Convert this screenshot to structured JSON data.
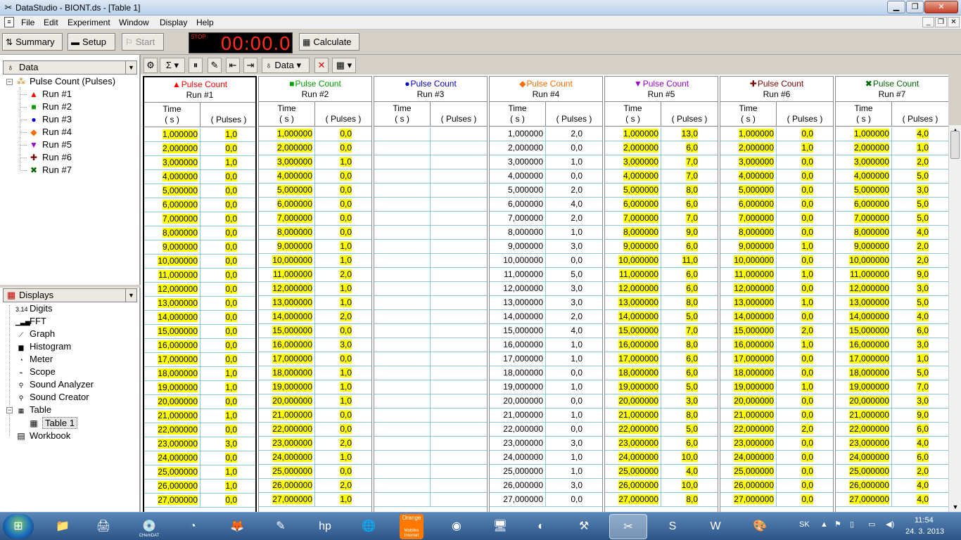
{
  "window": {
    "title": "DataStudio - BIONT.ds - [Table 1]",
    "min_label": "▁",
    "max_label": "❐",
    "close_label": "✕"
  },
  "menu": {
    "items": [
      "File",
      "Edit",
      "Experiment",
      "Window",
      "Display",
      "Help"
    ]
  },
  "toolbar": {
    "summary": "Summary",
    "setup": "Setup",
    "start": "Start",
    "stop": "STOP",
    "timer": "00:00.0",
    "calculate": "Calculate"
  },
  "data_panel": {
    "header": "Data",
    "root": "Pulse Count (Pulses)",
    "runs": [
      {
        "label": "Run #1",
        "marker": "▲",
        "color": "#ff0000"
      },
      {
        "label": "Run #2",
        "marker": "■",
        "color": "#00a000"
      },
      {
        "label": "Run #3",
        "marker": "●",
        "color": "#0000cc"
      },
      {
        "label": "Run #4",
        "marker": "◆",
        "color": "#ff6a00"
      },
      {
        "label": "Run #5",
        "marker": "▼",
        "color": "#9900cc"
      },
      {
        "label": "Run #6",
        "marker": "✚",
        "color": "#800000"
      },
      {
        "label": "Run #7",
        "marker": "✖",
        "color": "#006600"
      }
    ]
  },
  "displays_panel": {
    "header": "Displays",
    "items": [
      {
        "label": "Digits",
        "icon": "3.14"
      },
      {
        "label": "FFT",
        "icon": "▁▃▅"
      },
      {
        "label": "Graph",
        "icon": "⟋"
      },
      {
        "label": "Histogram",
        "icon": "▆"
      },
      {
        "label": "Meter",
        "icon": "◔"
      },
      {
        "label": "Scope",
        "icon": "⌁"
      },
      {
        "label": "Sound Analyzer",
        "icon": "⚲"
      },
      {
        "label": "Sound Creator",
        "icon": "⚲"
      },
      {
        "label": "Table",
        "icon": "▦"
      }
    ],
    "table_child": "Table 1",
    "workbook": "Workbook"
  },
  "table_toolbar": {
    "data_label": "Data"
  },
  "table": {
    "column_title": "Pulse Count",
    "time_label": "Time",
    "time_unit": "( s )",
    "value_unit": "( Pulses )",
    "times": [
      "1,000000",
      "2,000000",
      "3,000000",
      "4,000000",
      "5,000000",
      "6,000000",
      "7,000000",
      "8,000000",
      "9,000000",
      "10,000000",
      "11,000000",
      "12,000000",
      "13,000000",
      "14,000000",
      "15,000000",
      "16,000000",
      "17,000000",
      "18,000000",
      "19,000000",
      "20,000000",
      "21,000000",
      "22,000000",
      "23,000000",
      "24,000000",
      "25,000000",
      "26,000000",
      "27,000000"
    ],
    "runs": [
      {
        "name": "Run #1",
        "marker": "▲",
        "color": "#ff0000",
        "title_color": "#ff0000",
        "highlight": true,
        "active": true,
        "values": [
          "1,0",
          "0,0",
          "1,0",
          "0,0",
          "0,0",
          "0,0",
          "0,0",
          "0,0",
          "0,0",
          "0,0",
          "0,0",
          "0,0",
          "0,0",
          "0,0",
          "0,0",
          "0,0",
          "0,0",
          "1,0",
          "1,0",
          "0,0",
          "1,0",
          "0,0",
          "3,0",
          "0,0",
          "1,0",
          "1,0",
          "0,0"
        ]
      },
      {
        "name": "Run #2",
        "marker": "■",
        "color": "#00a000",
        "title_color": "#00a000",
        "highlight": true,
        "active": false,
        "values": [
          "0,0",
          "0,0",
          "1,0",
          "0,0",
          "0,0",
          "0,0",
          "0,0",
          "0,0",
          "1,0",
          "1,0",
          "2,0",
          "1,0",
          "1,0",
          "2,0",
          "0,0",
          "3,0",
          "0,0",
          "1,0",
          "1,0",
          "1,0",
          "0,0",
          "0,0",
          "2,0",
          "1,0",
          "0,0",
          "2,0",
          "1,0"
        ]
      },
      {
        "name": "Run #3",
        "marker": "●",
        "color": "#0000cc",
        "title_color": "#0000cc",
        "highlight": false,
        "active": false,
        "values": []
      },
      {
        "name": "Run #4",
        "marker": "◆",
        "color": "#ff6a00",
        "title_color": "#ff6a00",
        "highlight": false,
        "active": false,
        "values": [
          "2,0",
          "0,0",
          "1,0",
          "0,0",
          "2,0",
          "4,0",
          "2,0",
          "1,0",
          "3,0",
          "0,0",
          "5,0",
          "3,0",
          "3,0",
          "2,0",
          "4,0",
          "1,0",
          "1,0",
          "0,0",
          "1,0",
          "0,0",
          "1,0",
          "0,0",
          "3,0",
          "1,0",
          "1,0",
          "3,0",
          "0,0"
        ]
      },
      {
        "name": "Run #5",
        "marker": "▼",
        "color": "#9900cc",
        "title_color": "#9900cc",
        "highlight": true,
        "active": false,
        "values": [
          "13,0",
          "6,0",
          "7,0",
          "7,0",
          "8,0",
          "6,0",
          "7,0",
          "9,0",
          "6,0",
          "11,0",
          "6,0",
          "6,0",
          "8,0",
          "5,0",
          "7,0",
          "8,0",
          "6,0",
          "6,0",
          "5,0",
          "3,0",
          "8,0",
          "5,0",
          "6,0",
          "10,0",
          "4,0",
          "10,0",
          "8,0"
        ]
      },
      {
        "name": "Run #6",
        "marker": "✚",
        "color": "#800000",
        "title_color": "#800000",
        "highlight": true,
        "active": false,
        "values": [
          "0,0",
          "1,0",
          "0,0",
          "0,0",
          "0,0",
          "0,0",
          "0,0",
          "0,0",
          "1,0",
          "0,0",
          "1,0",
          "0,0",
          "1,0",
          "0,0",
          "2,0",
          "1,0",
          "0,0",
          "0,0",
          "1,0",
          "0,0",
          "0,0",
          "2,0",
          "0,0",
          "0,0",
          "0,0",
          "0,0",
          "0,0"
        ]
      },
      {
        "name": "Run #7",
        "marker": "✖",
        "color": "#006600",
        "title_color": "#006600",
        "highlight": true,
        "active": false,
        "values": [
          "4,0",
          "1,0",
          "2,0",
          "5,0",
          "3,0",
          "5,0",
          "5,0",
          "4,0",
          "2,0",
          "2,0",
          "9,0",
          "3,0",
          "5,0",
          "4,0",
          "6,0",
          "3,0",
          "1,0",
          "5,0",
          "7,0",
          "3,0",
          "9,0",
          "6,0",
          "4,0",
          "6,0",
          "2,0",
          "4,0",
          "4,0"
        ]
      }
    ]
  },
  "taskbar": {
    "apps": [
      {
        "name": "explorer",
        "glyph": "📁",
        "label": ""
      },
      {
        "name": "scanner",
        "glyph": "🖨",
        "label": ""
      },
      {
        "name": "chemdat",
        "glyph": "💿",
        "label": "CHemDAT"
      },
      {
        "name": "media",
        "glyph": "◔",
        "label": ""
      },
      {
        "name": "firefox",
        "glyph": "🦊",
        "label": ""
      },
      {
        "name": "app-tool",
        "glyph": "✎",
        "label": ""
      },
      {
        "name": "hp",
        "glyph": "hp",
        "label": ""
      },
      {
        "name": "globe",
        "glyph": "🌐",
        "label": ""
      },
      {
        "name": "orange",
        "glyph": "Orange",
        "label": "Mobiles Internet"
      },
      {
        "name": "webcam",
        "glyph": "◉",
        "label": ""
      },
      {
        "name": "monitor",
        "glyph": "🖥",
        "label": ""
      },
      {
        "name": "media2",
        "glyph": "◐",
        "label": ""
      },
      {
        "name": "tool",
        "glyph": "⚒",
        "label": ""
      },
      {
        "name": "datastudio",
        "glyph": "✂",
        "label": ""
      },
      {
        "name": "skype",
        "glyph": "S",
        "label": ""
      },
      {
        "name": "word",
        "glyph": "W",
        "label": ""
      },
      {
        "name": "paint",
        "glyph": "🎨",
        "label": ""
      }
    ],
    "lang": "SK",
    "clock_time": "11:54",
    "clock_date": "24. 3. 2013"
  }
}
